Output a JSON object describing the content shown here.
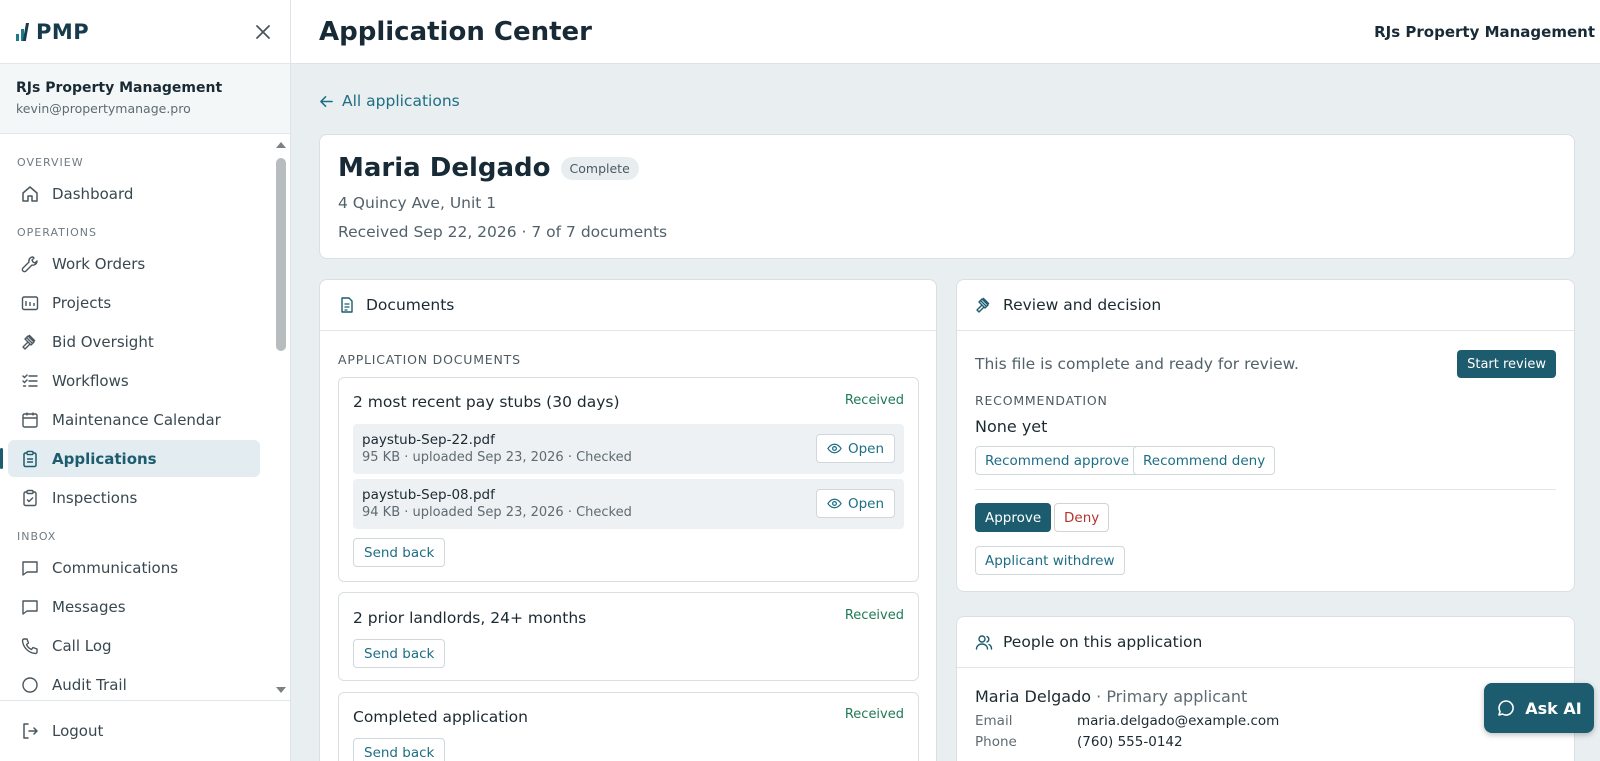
{
  "app": {
    "logo_text": "PMP",
    "page_title": "Application Center",
    "top_org": "RJs Property Management"
  },
  "sidebar": {
    "org_name": "RJs Property Management",
    "org_email": "kevin@propertymanage.pro",
    "sections": {
      "overview": "OVERVIEW",
      "operations": "OPERATIONS",
      "inbox": "INBOX"
    },
    "items": [
      {
        "label": "Dashboard",
        "icon": "home-icon"
      },
      {
        "label": "Work Orders",
        "icon": "wrench-icon"
      },
      {
        "label": "Projects",
        "icon": "folder-icon"
      },
      {
        "label": "Bid Oversight",
        "icon": "gavel-icon"
      },
      {
        "label": "Workflows",
        "icon": "checklist-icon"
      },
      {
        "label": "Maintenance Calendar",
        "icon": "calendar-icon"
      },
      {
        "label": "Applications",
        "icon": "clipboard-icon",
        "active": true
      },
      {
        "label": "Inspections",
        "icon": "clipboard-check-icon"
      },
      {
        "label": "Communications",
        "icon": "chat-icon"
      },
      {
        "label": "Messages",
        "icon": "message-icon"
      },
      {
        "label": "Call Log",
        "icon": "phone-icon"
      },
      {
        "label": "Audit Trail",
        "icon": "audit-icon"
      }
    ],
    "logout": "Logout"
  },
  "main": {
    "back_link": "All applications",
    "applicant": {
      "name": "Maria Delgado",
      "status": "Complete",
      "address": "4 Quincy Ave, Unit 1",
      "received": "Received Sep 22, 2026 · 7 of 7 documents"
    },
    "documents": {
      "title": "Documents",
      "caption": "APPLICATION DOCUMENTS",
      "groups": [
        {
          "title": "2 most recent pay stubs (30 days)",
          "status": "Received",
          "files": [
            {
              "name": "paystub-Sep-22.pdf",
              "meta": "95 KB · uploaded Sep 23, 2026 · Checked",
              "action": "Open"
            },
            {
              "name": "paystub-Sep-08.pdf",
              "meta": "94 KB · uploaded Sep 23, 2026 · Checked",
              "action": "Open"
            }
          ],
          "send_back": "Send back"
        },
        {
          "title": "2 prior landlords, 24+ months",
          "status": "Received",
          "send_back": "Send back"
        },
        {
          "title": "Completed application",
          "status": "Received",
          "send_back": "Send back"
        }
      ]
    },
    "review": {
      "title": "Review and decision",
      "ready_text": "This file is complete and ready for review.",
      "start_review": "Start review",
      "recommendation_caption": "RECOMMENDATION",
      "recommendation_value": "None yet",
      "recommend_approve": "Recommend approve",
      "recommend_deny": "Recommend deny",
      "approve": "Approve",
      "deny": "Deny",
      "applicant_withdrew": "Applicant withdrew"
    },
    "people": {
      "title": "People on this application",
      "person_name": "Maria Delgado",
      "person_role": "· Primary applicant",
      "email_label": "Email",
      "email": "maria.delgado@example.com",
      "phone_label": "Phone",
      "phone": "(760) 555-0142"
    }
  },
  "ask_ai": "Ask AI",
  "colors": {
    "accent": "#1c5c6e",
    "link": "#1d6e84",
    "received": "#1f7a55",
    "deny": "#b3342c"
  }
}
